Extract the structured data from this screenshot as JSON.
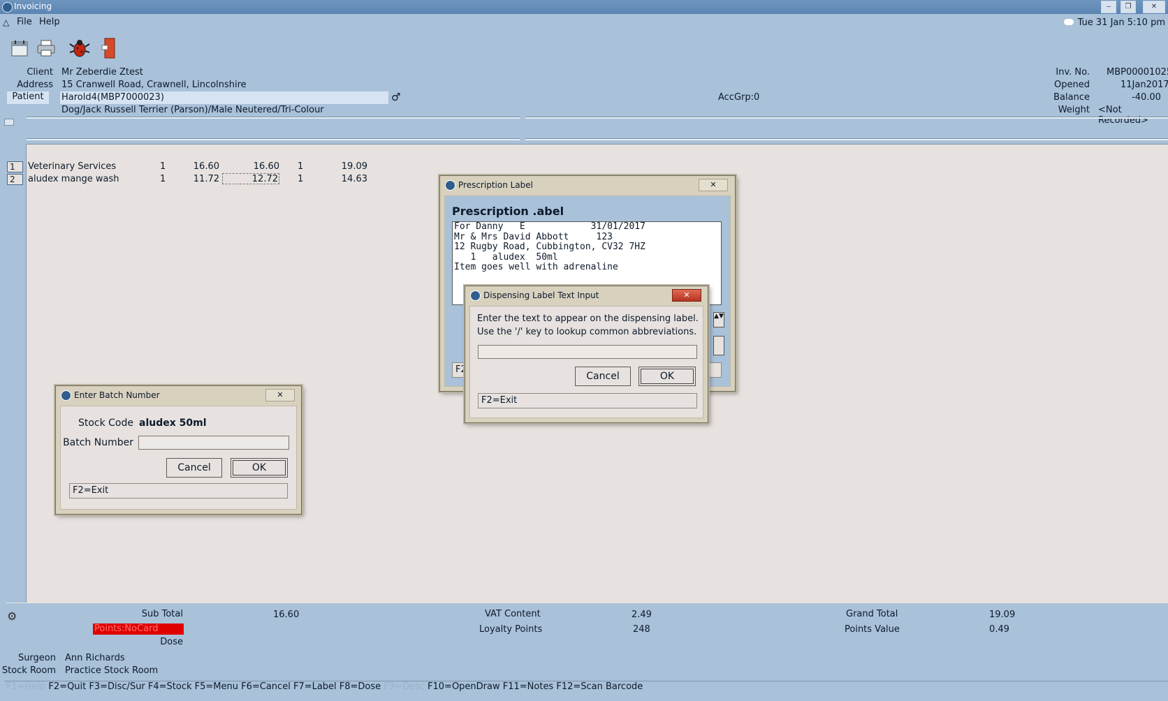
{
  "window": {
    "title": "Invoicing"
  },
  "menu": {
    "file": "File",
    "help": "Help"
  },
  "clock": "Tue 31 Jan 5:10 pm",
  "toolbar": {
    "icons": [
      "calendar-icon",
      "printer-icon",
      "bug-icon",
      "exit-door-icon"
    ]
  },
  "header": {
    "client_label": "Client",
    "client_value": "Mr Zeberdie Ztest",
    "address_label": "Address",
    "address_value": "15 Cranwell Road, Crawnell, Lincolnshire",
    "patient_label": "Patient",
    "patient_value": "Harold4(MBP7000023)",
    "animal_desc": "Dog/Jack Russell Terrier (Parson)/Male Neutered/Tri-Colour",
    "accgrp": "AccGrp:0",
    "inv_label": "Inv. No.",
    "inv_value": "MBP00001025",
    "opened_label": "Opened",
    "opened_value": "11Jan2017",
    "balance_label": "Balance",
    "balance_value": "-40.00",
    "weight_label": "Weight",
    "weight_value": "<Not Recorded>"
  },
  "lines": [
    {
      "no": "1",
      "desc": "Veterinary Services",
      "qty": "1",
      "price": "16.60",
      "net": "16.60",
      "vat": "1",
      "total": "19.09"
    },
    {
      "no": "2",
      "desc": "aludex mange wash",
      "qty": "1",
      "price": "11.72",
      "net": "12.72",
      "vat": "1",
      "total": "14.63"
    }
  ],
  "totals": {
    "subtotal_label": "Sub Total",
    "subtotal_value": "16.60",
    "vat_label": "VAT Content",
    "vat_value": "2.49",
    "grand_label": "Grand Total",
    "grand_value": "19.09",
    "points_badge": "Points:NoCard",
    "loyalty_label": "Loyalty Points",
    "loyalty_value": "248",
    "pointsvalue_label": "Points Value",
    "pointsvalue_value": "0.49",
    "dose_label": "Dose",
    "surgeon_label": "Surgeon",
    "surgeon_value": "Ann Richards",
    "stockroom_label": "Stock Room",
    "stockroom_value": "Practice Stock Room"
  },
  "fkeys": {
    "f1": "F1=Help",
    "main": "F2=Quit F3=Disc/Sur F4=Stock F5=Menu F6=Cancel F7=Label F8=Dose",
    "f9": "F9=Desc",
    "rest": "F10=OpenDraw F11=Notes F12=Scan Barcode"
  },
  "batch_dialog": {
    "title": "Enter Batch Number",
    "stock_code_label": "Stock Code",
    "stock_code_value": "aludex  50ml",
    "batch_label": "Batch Number",
    "batch_value": "",
    "cancel": "Cancel",
    "ok": "OK",
    "status": "F2=Exit"
  },
  "prescription_dialog": {
    "title": "Prescription Label",
    "heading": "Prescription  .abel",
    "label_lines": [
      "For Danny   E            31/01/2017",
      "Mr & Mrs David Abbott     123",
      "12 Rugby Road, Cubbington, CV32 7HZ",
      "   1   aludex  50ml",
      "Item goes well with adrenaline"
    ],
    "status_partial": "F2"
  },
  "dispense_dialog": {
    "title": "Dispensing Label Text Input",
    "prompt1": "Enter the text to appear on the dispensing label.",
    "prompt2": "Use the '/' key to lookup common abbreviations.",
    "input_value": "",
    "cancel": "Cancel",
    "ok": "OK",
    "status": "F2=Exit"
  }
}
